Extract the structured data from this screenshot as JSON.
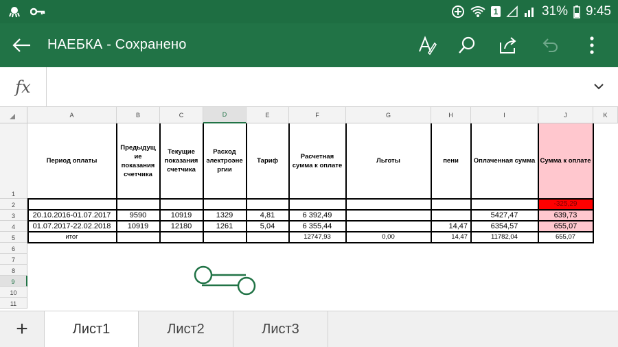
{
  "status_bar": {
    "battery_percent": "31%",
    "time": "9:45",
    "notification_badge": "1"
  },
  "app_bar": {
    "title": "НАЕБКА - Сохранено",
    "icons": [
      "back-arrow-icon",
      "text-format-icon",
      "search-icon",
      "share-icon",
      "undo-icon",
      "more-vert-icon"
    ]
  },
  "formula_bar": {
    "fx_label": "fx",
    "value": ""
  },
  "grid": {
    "column_headers": [
      "A",
      "B",
      "C",
      "D",
      "E",
      "F",
      "G",
      "H",
      "I",
      "J",
      "K"
    ],
    "selected_column": "D",
    "row_headers": [
      "1",
      "2",
      "3",
      "4",
      "5",
      "6",
      "7",
      "8",
      "9",
      "10",
      "11"
    ],
    "selected_row": "9",
    "header_row": {
      "A": "Период оплаты",
      "B": "Предыдущие показания счетчика",
      "C": "Текущие показания счетчика",
      "D": "Расход электроэнергии",
      "E": "Тариф",
      "F": "Расчетная сумма к оплате",
      "G": "Льготы",
      "H": "пени",
      "I": "Оплаченная сумма",
      "J": "Сумма к оплате"
    },
    "header_row_display": {
      "B": "Предыдущ ие показания счетчика",
      "D": "Расход электроэне ргии"
    },
    "rows": [
      {
        "row": "2",
        "J": "-325,29"
      },
      {
        "row": "3",
        "A": "20.10.2016-01.07.2017",
        "B": "9590",
        "C": "10919",
        "D": "1329",
        "E": "4,81",
        "F": "6 392,49",
        "G": "",
        "H": "",
        "I": "5427,47",
        "J": "639,73"
      },
      {
        "row": "4",
        "A": "01.07.2017-22.02.2018",
        "B": "10919",
        "C": "12180",
        "D": "1261",
        "E": "5,04",
        "F": "6 355,44",
        "G": "",
        "H": "14,47",
        "I": "6354,57",
        "J": "655,07"
      },
      {
        "row": "5",
        "A": "итог",
        "F": "12747,93",
        "G": "0,00",
        "H": "14,47",
        "I": "11782,04",
        "J": "655,07"
      }
    ],
    "colors": {
      "pink_fill": "#ffc7ce",
      "red_fill": "#ff0000",
      "accent": "#217346"
    }
  },
  "sheet_tabs": {
    "add_label": "+",
    "tabs": [
      "Лист1",
      "Лист2",
      "Лист3"
    ],
    "active": "Лист1"
  }
}
